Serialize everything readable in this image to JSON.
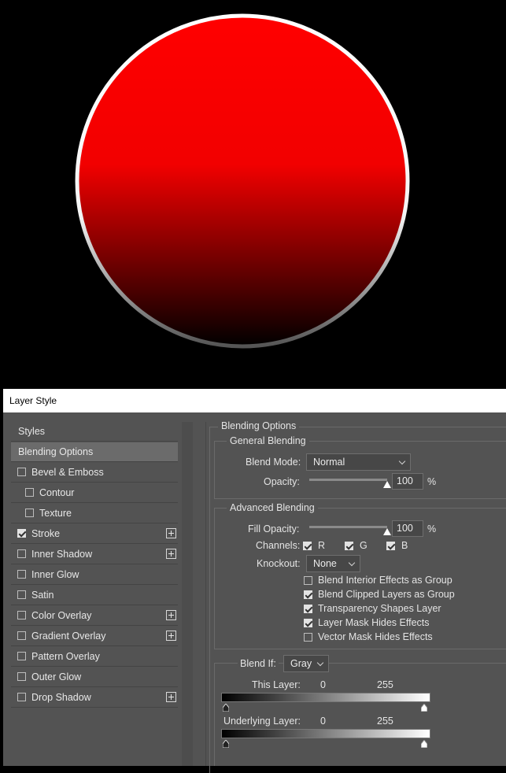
{
  "dialog": {
    "title": "Layer Style",
    "accent": "#ff0000"
  },
  "style_list": {
    "header": "Styles",
    "items": [
      {
        "label": "Blending Options",
        "checkbox": null,
        "plus": false,
        "selected": true
      },
      {
        "label": "Bevel & Emboss",
        "checkbox": false,
        "plus": false
      },
      {
        "label": "Contour",
        "checkbox": false,
        "plus": false,
        "indent": true
      },
      {
        "label": "Texture",
        "checkbox": false,
        "plus": false,
        "indent": true
      },
      {
        "label": "Stroke",
        "checkbox": true,
        "plus": true
      },
      {
        "label": "Inner Shadow",
        "checkbox": false,
        "plus": true
      },
      {
        "label": "Inner Glow",
        "checkbox": false,
        "plus": false
      },
      {
        "label": "Satin",
        "checkbox": false,
        "plus": false
      },
      {
        "label": "Color Overlay",
        "checkbox": false,
        "plus": true
      },
      {
        "label": "Gradient Overlay",
        "checkbox": false,
        "plus": true
      },
      {
        "label": "Pattern Overlay",
        "checkbox": false,
        "plus": false
      },
      {
        "label": "Outer Glow",
        "checkbox": false,
        "plus": false
      },
      {
        "label": "Drop Shadow",
        "checkbox": false,
        "plus": true
      }
    ]
  },
  "blending": {
    "section_title": "Blending Options",
    "general_title": "General Blending",
    "blend_mode_label": "Blend Mode:",
    "blend_mode_value": "Normal",
    "opacity_label": "Opacity:",
    "opacity_value": "100",
    "opacity_level": 100,
    "percent": "%",
    "advanced_title": "Advanced Blending",
    "fill_opacity_label": "Fill Opacity:",
    "fill_opacity_value": "100",
    "fill_opacity_level": 100,
    "channels_label": "Channels:",
    "channel_r": "R",
    "channel_g": "G",
    "channel_b": "B",
    "knockout_label": "Knockout:",
    "knockout_value": "None",
    "options": [
      {
        "label": "Blend Interior Effects as Group",
        "checked": false
      },
      {
        "label": "Blend Clipped Layers as Group",
        "checked": true
      },
      {
        "label": "Transparency Shapes Layer",
        "checked": true
      },
      {
        "label": "Layer Mask Hides Effects",
        "checked": true
      },
      {
        "label": "Vector Mask Hides Effects",
        "checked": false
      }
    ]
  },
  "blend_if": {
    "label": "Blend If:",
    "value": "Gray",
    "this_layer_label": "This Layer:",
    "this_layer_min": "0",
    "this_layer_max": "255",
    "underlying_label": "Underlying Layer:",
    "underlying_min": "0",
    "underlying_max": "255"
  }
}
